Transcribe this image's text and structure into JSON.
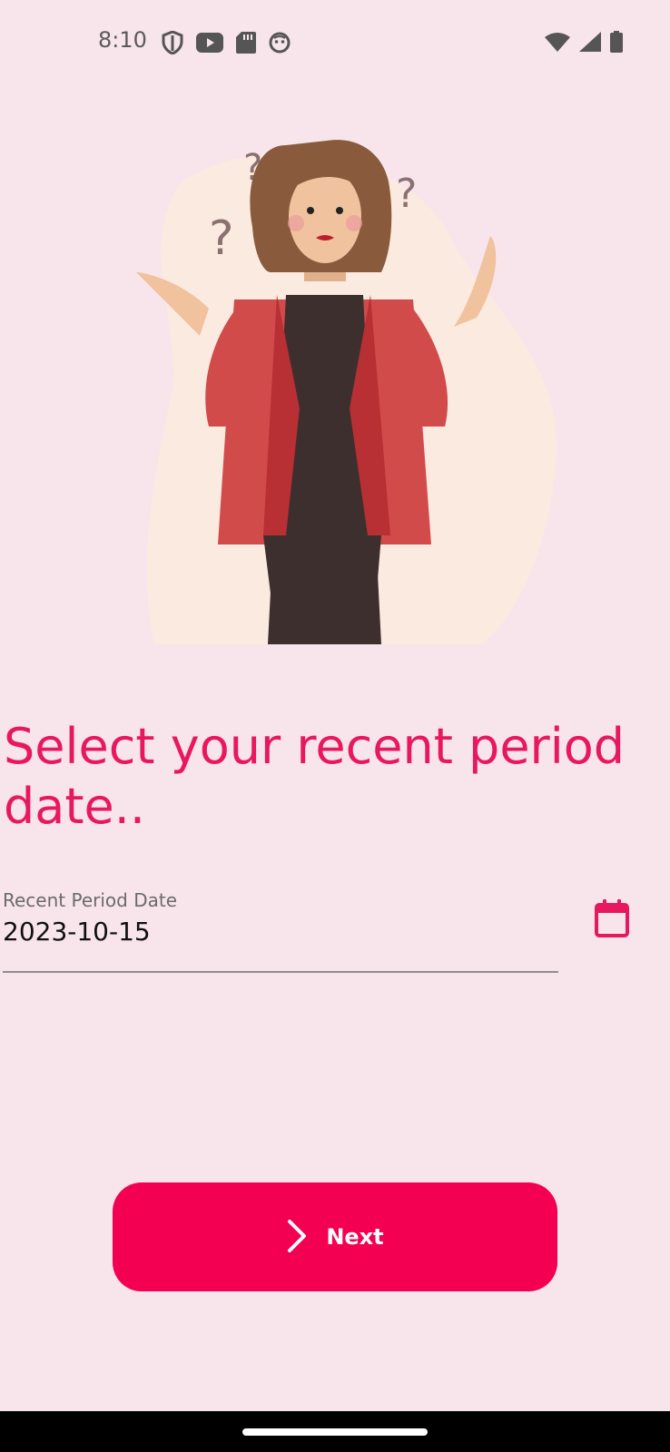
{
  "status_bar": {
    "time": "8:10",
    "left_icons": [
      "shield-icon",
      "youtube-icon",
      "sd-card-icon",
      "android-icon"
    ],
    "right_icons": [
      "wifi-icon",
      "signal-icon",
      "battery-icon"
    ]
  },
  "main": {
    "headline": "Select your recent period date..",
    "date_field": {
      "label": "Recent Period Date",
      "value": "2023-10-15",
      "icon": "calendar-icon"
    },
    "next_button": {
      "label": "Next",
      "icon": "chevron-right-icon"
    }
  },
  "colors": {
    "background": "#f8e5ec",
    "accent": "#e8185f",
    "button": "#f30052"
  }
}
